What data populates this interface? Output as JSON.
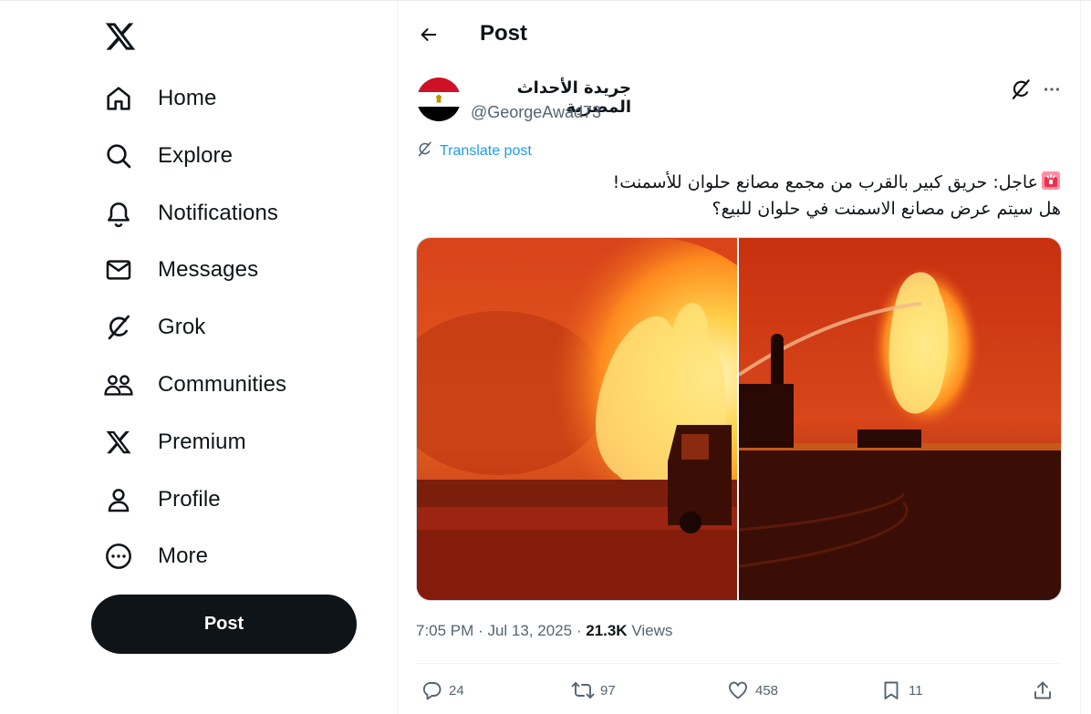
{
  "nav": {
    "logo_icon": "x-logo",
    "items": [
      {
        "label": "Home",
        "icon": "home-icon"
      },
      {
        "label": "Explore",
        "icon": "search-icon"
      },
      {
        "label": "Notifications",
        "icon": "bell-icon"
      },
      {
        "label": "Messages",
        "icon": "envelope-icon"
      },
      {
        "label": "Grok",
        "icon": "grok-icon"
      },
      {
        "label": "Communities",
        "icon": "people-icon"
      },
      {
        "label": "Premium",
        "icon": "x-icon"
      },
      {
        "label": "Profile",
        "icon": "person-icon"
      },
      {
        "label": "More",
        "icon": "more-circle-icon"
      }
    ],
    "post_button": "Post"
  },
  "header": {
    "title": "Post"
  },
  "post": {
    "author_name": "جريدة الأحداث المصرية",
    "author_handle": "@GeorgeAwad73",
    "translate_label": "Translate post",
    "text_line1": "عاجل: حريق كبير بالقرب من مجمع مصانع حلوان للأسمنت!",
    "text_line2": "هل سيتم عرض مصانع الاسمنت في حلوان للبيع؟",
    "time": "7:05 PM",
    "date": "Jul 13, 2025",
    "views_count": "21.3K",
    "views_label": "Views",
    "replies": "24",
    "reposts": "97",
    "likes": "458",
    "bookmarks": "11"
  },
  "colors": {
    "accent": "#1d9bf0",
    "text": "#0f1419",
    "muted": "#536471",
    "post_button_bg": "#0f1419"
  }
}
